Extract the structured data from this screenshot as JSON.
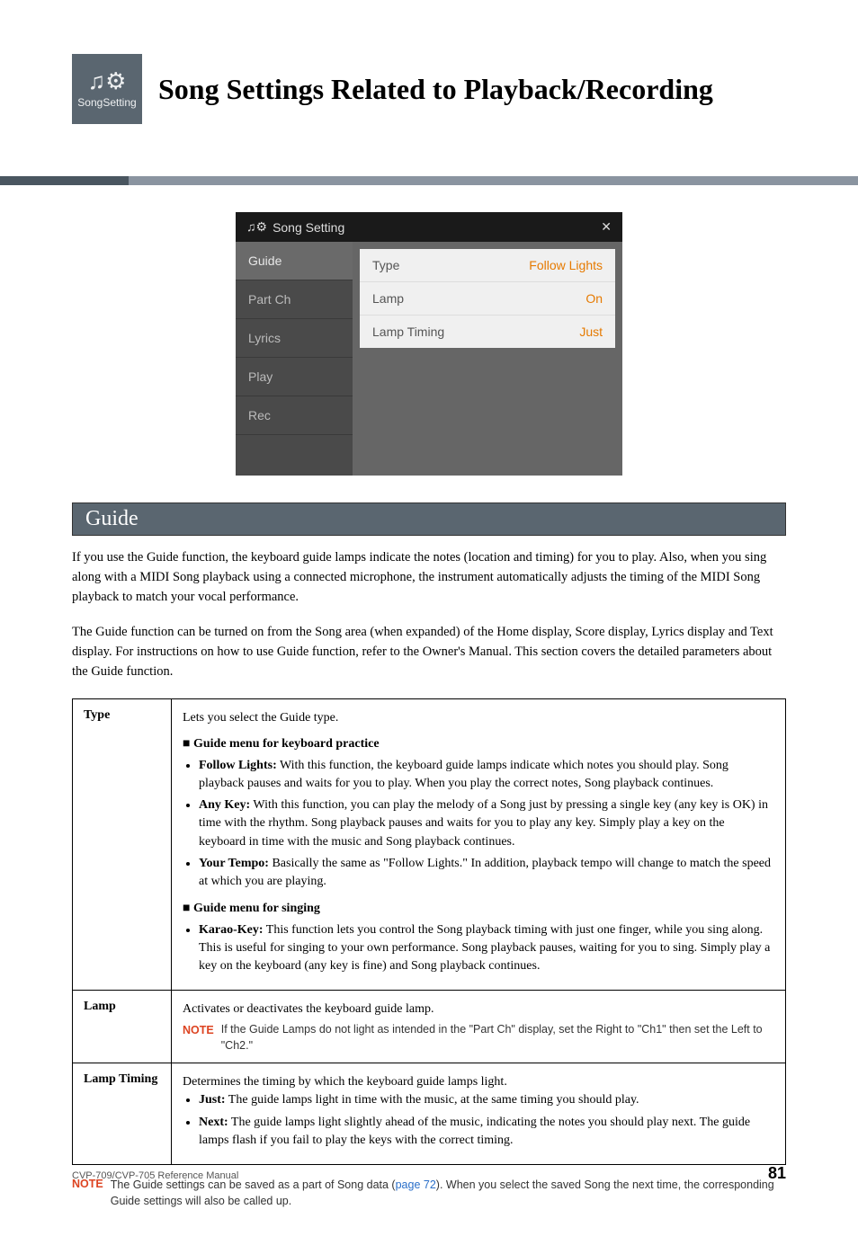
{
  "header": {
    "icon_label": "SongSetting",
    "icon_glyph": "♫⚙",
    "title": "Song Settings Related to Playback/Recording"
  },
  "screenshot": {
    "titlebar_icon": "♫⚙",
    "titlebar_text": "Song Setting",
    "close_glyph": "✕",
    "sidebar": [
      {
        "label": "Guide",
        "active": true
      },
      {
        "label": "Part Ch",
        "active": false
      },
      {
        "label": "Lyrics",
        "active": false
      },
      {
        "label": "Play",
        "active": false
      },
      {
        "label": "Rec",
        "active": false
      }
    ],
    "rows": [
      {
        "label": "Type",
        "value": "Follow Lights"
      },
      {
        "label": "Lamp",
        "value": "On"
      },
      {
        "label": "Lamp Timing",
        "value": "Just"
      }
    ]
  },
  "section": {
    "heading": "Guide",
    "intro_p1": "If you use the Guide function, the keyboard guide lamps indicate the notes (location and timing) for you to play. Also, when you sing along with a MIDI Song playback using a connected microphone, the instrument automatically adjusts the timing of the MIDI Song playback to match your vocal performance.",
    "intro_p2": "The Guide function can be turned on from the Song area (when expanded) of the Home display, Score display, Lyrics display and Text display. For instructions on how to use Guide function, refer to the Owner's Manual. This section covers the detailed parameters about the Guide function."
  },
  "table": {
    "type": {
      "label": "Type",
      "intro": "Lets you select the Guide type.",
      "menu1_head": "Guide menu for keyboard practice",
      "menu1_items": [
        {
          "name": "Follow Lights:",
          "text": " With this function, the keyboard guide lamps indicate which notes you should play. Song playback pauses and waits for you to play. When you play the correct notes, Song playback continues."
        },
        {
          "name": "Any Key:",
          "text": " With this function, you can play the melody of a Song just by pressing a single key (any key is OK) in time with the rhythm. Song playback pauses and waits for you to play any key. Simply play a key on the keyboard in time with the music and Song playback continues."
        },
        {
          "name": "Your Tempo:",
          "text": " Basically the same as \"Follow Lights.\" In addition, playback tempo will change to match the speed at which you are playing."
        }
      ],
      "menu2_head": "Guide menu for singing",
      "menu2_items": [
        {
          "name": "Karao-Key:",
          "text": " This function lets you control the Song playback timing with just one finger, while you sing along. This is useful for singing to your own performance. Song playback pauses, waiting for you to sing. Simply play a key on the keyboard (any key is fine) and Song playback continues."
        }
      ]
    },
    "lamp": {
      "label": "Lamp",
      "text": "Activates or deactivates the keyboard guide lamp.",
      "note_label": "NOTE",
      "note_text": "If the Guide Lamps do not light as intended in the \"Part Ch\" display, set the Right to \"Ch1\" then set the Left to \"Ch2.\""
    },
    "lamp_timing": {
      "label": "Lamp Timing",
      "intro": "Determines the timing by which the keyboard guide lamps light.",
      "items": [
        {
          "name": "Just:",
          "text": " The guide lamps light in time with the music, at the same timing you should play."
        },
        {
          "name": "Next:",
          "text": " The guide lamps light slightly ahead of the music, indicating the notes you should play next. The guide lamps flash if you fail to play the keys with the correct timing."
        }
      ]
    }
  },
  "footer_note": {
    "label": "NOTE",
    "pre": "The Guide settings can be saved as a part of Song data (",
    "link": "page 72",
    "post": "). When you select the saved Song the next time, the corresponding Guide settings will also be called up."
  },
  "footer": {
    "manual": "CVP-709/CVP-705 Reference Manual",
    "page": "81"
  }
}
